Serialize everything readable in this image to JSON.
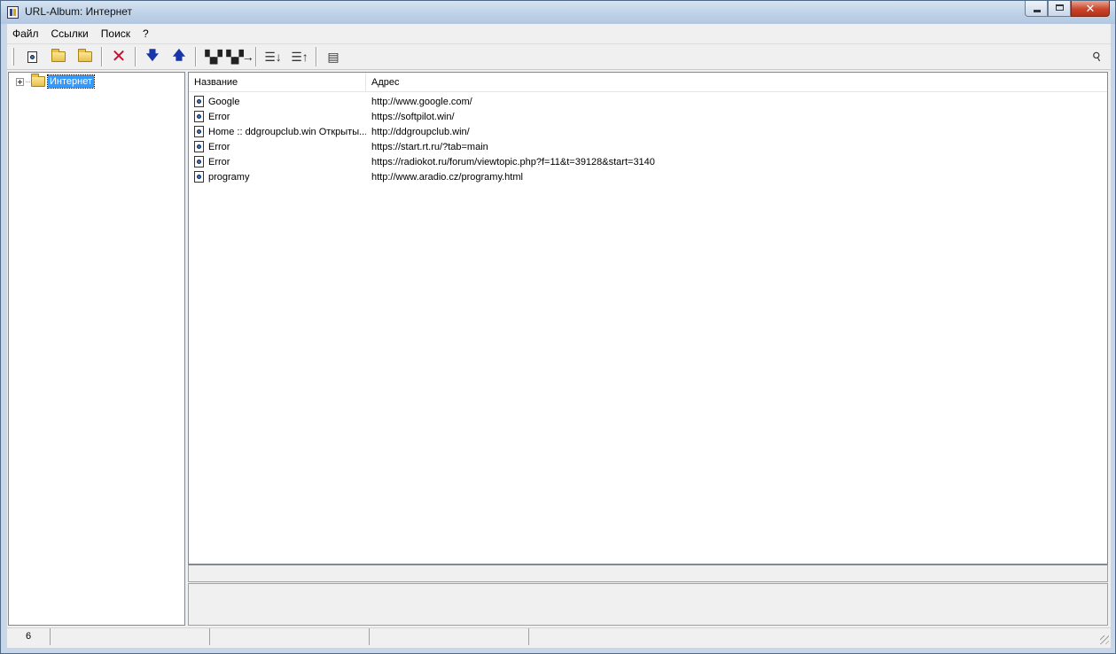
{
  "window": {
    "title": "URL-Album: Интернет"
  },
  "menu": [
    "Файл",
    "Ссылки",
    "Поиск",
    "?"
  ],
  "tree": {
    "root_label": "Интернет"
  },
  "list": {
    "columns": {
      "name": "Название",
      "address": "Адрес"
    },
    "rows": [
      {
        "name": "Google",
        "address": "http://www.google.com/"
      },
      {
        "name": "Error",
        "address": "https://softpilot.win/"
      },
      {
        "name": "Home :: ddgroupclub.win Открыты...",
        "address": "http://ddgroupclub.win/"
      },
      {
        "name": "Error",
        "address": "https://start.rt.ru/?tab=main"
      },
      {
        "name": "Error",
        "address": "https://radiokot.ru/forum/viewtopic.php?f=11&t=39128&start=3140"
      },
      {
        "name": "programy",
        "address": "http://www.aradio.cz/programy.html"
      }
    ]
  },
  "status": {
    "count": "6"
  },
  "icons": {
    "toolbar": [
      "new-link-icon",
      "open-folder-icon",
      "new-folder-icon",
      "delete-icon",
      "move-down-icon",
      "move-up-icon",
      "find-icon",
      "find-next-icon",
      "sort-down-icon",
      "sort-up-icon",
      "properties-icon",
      "pin-icon"
    ]
  },
  "colors": {
    "selection": "#3399ff",
    "delete_red": "#c8102e",
    "arrow_blue": "#1936a8"
  }
}
